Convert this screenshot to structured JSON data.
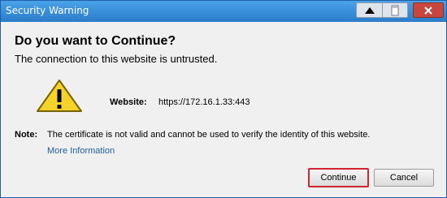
{
  "window": {
    "title": "Security Warning"
  },
  "dialog": {
    "heading": "Do you want to Continue?",
    "subheading": "The connection to this website is untrusted.",
    "website_label": "Website:",
    "website_url": "https://172.16.1.33:443",
    "note_label": "Note:",
    "note_text": "The certificate is not valid and cannot be used to verify the identity of this website.",
    "more_info_link": "More Information"
  },
  "buttons": {
    "continue_label": "Continue",
    "cancel_label": "Cancel"
  },
  "icons": {
    "warning": "warning-icon",
    "scroll_up": "triangle-up-icon",
    "pin": "pin-icon",
    "close": "close-icon"
  },
  "colors": {
    "titlebar": "#2b7cc9",
    "close_button": "#c7463d",
    "warning_fill": "#f6d32b",
    "link": "#1f5fa0",
    "focus_outline": "#d0262d"
  }
}
